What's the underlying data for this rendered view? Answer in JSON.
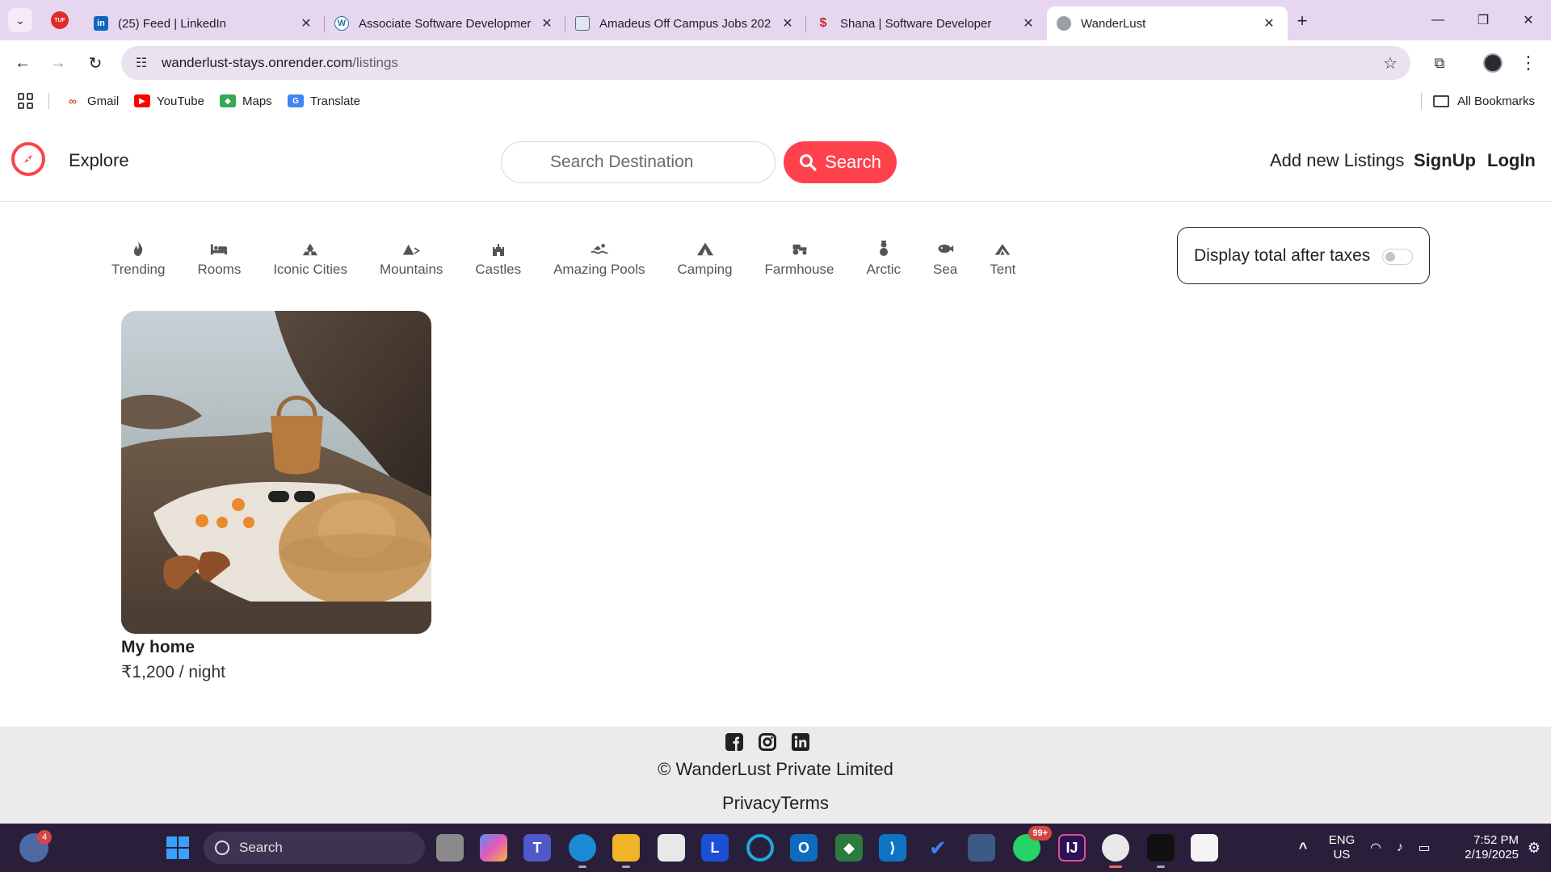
{
  "browser": {
    "tabs": [
      {
        "title": "(25) Feed | LinkedIn",
        "favicon": "linkedin-icon",
        "color": "#0a66c2"
      },
      {
        "title": "Associate Software Developmer",
        "favicon": "wordpress-icon",
        "color": "#21759b"
      },
      {
        "title": "Amadeus Off Campus Jobs 202",
        "favicon": "page-icon",
        "color": "#5a6b7b"
      },
      {
        "title": "Shana | Software Developer",
        "favicon": "dollar-icon",
        "color": "#c62828"
      },
      {
        "title": "WanderLust",
        "favicon": "globe-icon",
        "color": "#8a8a8a"
      }
    ],
    "url_host": "wanderlust-stays.onrender.com",
    "url_path": "/listings",
    "bookmarks": [
      {
        "label": "Gmail",
        "icon": "gmail-icon",
        "color": "#ea4335"
      },
      {
        "label": "YouTube",
        "icon": "youtube-icon",
        "color": "#ff0000"
      },
      {
        "label": "Maps",
        "icon": "maps-icon",
        "color": "#34a853"
      },
      {
        "label": "Translate",
        "icon": "translate-icon",
        "color": "#4285f4"
      }
    ],
    "all_bookmarks": "All Bookmarks"
  },
  "site": {
    "brand_color": "#fe424d",
    "explore": "Explore",
    "search_placeholder": "Search Destination",
    "search_button": "Search",
    "nav_links": [
      "Add new Listings",
      "SignUp",
      "LogIn"
    ],
    "filters": [
      {
        "label": "Trending",
        "icon": "fire-icon"
      },
      {
        "label": "Rooms",
        "icon": "bed-icon"
      },
      {
        "label": "Iconic Cities",
        "icon": "city-icon"
      },
      {
        "label": "Mountains",
        "icon": "mountain-icon"
      },
      {
        "label": "Castles",
        "icon": "castle-icon"
      },
      {
        "label": "Amazing Pools",
        "icon": "swimmer-icon"
      },
      {
        "label": "Camping",
        "icon": "tent-icon"
      },
      {
        "label": "Farmhouse",
        "icon": "tractor-icon"
      },
      {
        "label": "Arctic",
        "icon": "snowman-icon"
      },
      {
        "label": "Sea",
        "icon": "fish-icon"
      },
      {
        "label": "Tent",
        "icon": "campground-icon"
      }
    ],
    "tax_toggle_label": "Display total after taxes",
    "tax_toggle_on": false,
    "listing": {
      "title": "My home",
      "price": "₹1,200 / night"
    },
    "footer": {
      "social": [
        "facebook-icon",
        "instagram-icon",
        "linkedin-icon"
      ],
      "copyright": "© WanderLust Private Limited",
      "links": "PrivacyTerms"
    }
  },
  "taskbar": {
    "weather_badge": "4",
    "search_label": "Search",
    "whatsapp_badge": "99+",
    "lang_line1": "ENG",
    "lang_line2": "US",
    "time": "7:52 PM",
    "date": "2/19/2025"
  }
}
